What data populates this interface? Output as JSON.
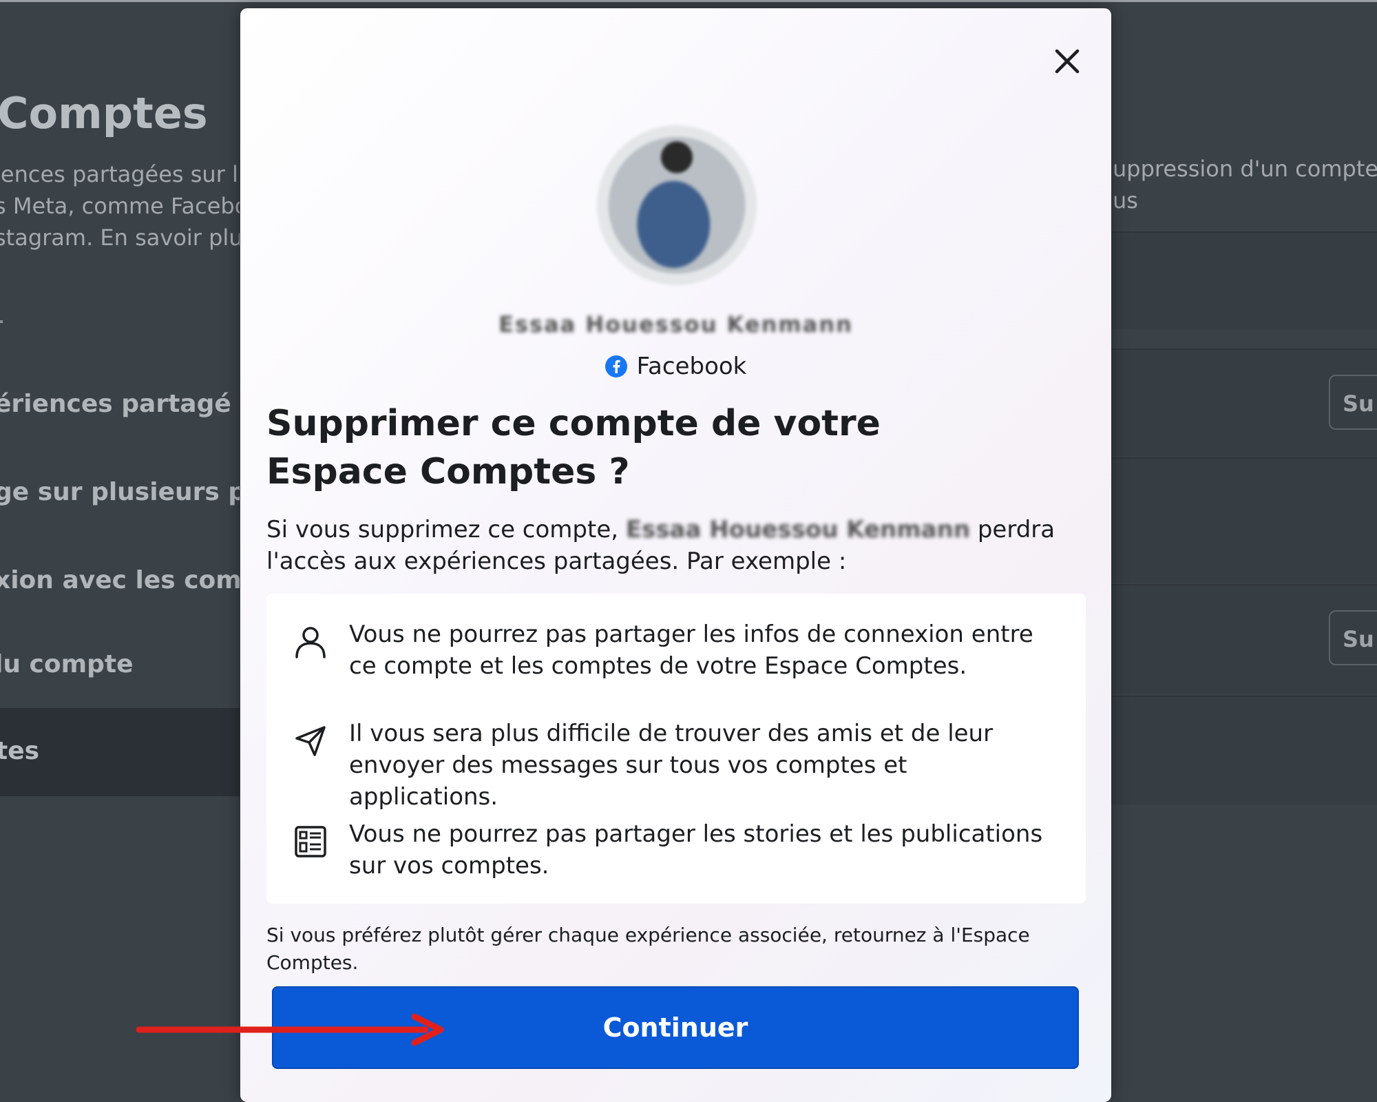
{
  "background": {
    "page_title": "Comptes",
    "desc_lines": [
      "iences partagées sur l'e",
      "s Meta, comme Facebo",
      "stagram. En savoir plus"
    ],
    "menu_items": [
      "ériences partagé",
      "ge sur plusieurs prof",
      "xion avec les compt",
      "lu compte"
    ],
    "active_menu_item": "tes",
    "right_desc_lines": [
      "uppression d'un compte e",
      "us"
    ],
    "right_button_label": "Su"
  },
  "modal": {
    "close_label": "×",
    "account_name": "Essaa Houessou Kenmann",
    "platform_name": "Facebook",
    "heading": "Supprimer ce compte de votre Espace Comptes ?",
    "intro_before": "Si vous supprimez ce compte, ",
    "intro_name": "Essaa Houessou Kenmann",
    "intro_after": " perdra l'accès aux expériences partagées. Par exemple :",
    "items": [
      {
        "icon": "person-icon",
        "text": "Vous ne pourrez pas partager les infos de connexion entre ce compte et les comptes de votre Espace Comptes."
      },
      {
        "icon": "send-icon",
        "text": "Il vous sera plus difficile de trouver des amis et de leur envoyer des messages sur tous vos comptes et applications."
      },
      {
        "icon": "feed-icon",
        "text": "Vous ne pourrez pas partager les stories et les publications sur vos comptes."
      }
    ],
    "footnote": "Si vous préférez plutôt gérer chaque expérience associée, retournez à l'Espace Comptes.",
    "continue_label": "Continuer"
  },
  "colors": {
    "primary_button": "#0a5ad8",
    "annotation_arrow": "#e0201b",
    "facebook_blue": "#1877f2"
  }
}
